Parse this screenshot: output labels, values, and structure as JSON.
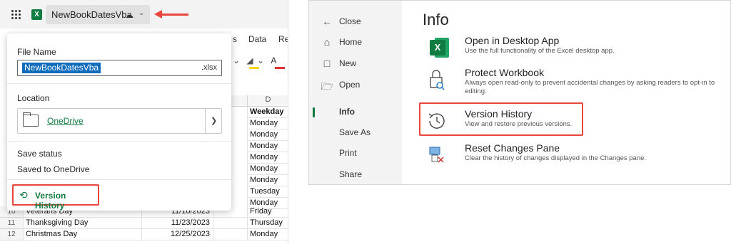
{
  "left_panel": {
    "file_title": "NewBookDatesVba",
    "ribbon_tabs": [
      "s",
      "Data",
      "Re"
    ],
    "popup": {
      "file_name_label": "File Name",
      "file_name_value": "NewBookDatesVba",
      "file_extension": ".xlsx",
      "location_label": "Location",
      "location_value": "OneDrive",
      "save_status_label": "Save status",
      "save_status_value": "Saved to OneDrive",
      "version_history_button": "Version History"
    },
    "sheet": {
      "column_header": "D",
      "header_cell": "Weekday",
      "weekdays": [
        "Monday",
        "Monday",
        "Monday",
        "Monday",
        "Monday",
        "Monday",
        "Tuesday",
        "Monday",
        "Monday"
      ],
      "rows": [
        {
          "num": "10",
          "name": "Veterans Day",
          "date": "11/10/2023",
          "weekday": "Friday"
        },
        {
          "num": "11",
          "name": "Thanksgiving Day",
          "date": "11/23/2023",
          "weekday": "Thursday"
        },
        {
          "num": "12",
          "name": "Christmas Day",
          "date": "12/25/2023",
          "weekday": "Monday"
        }
      ]
    }
  },
  "right_panel": {
    "nav": {
      "close": "Close",
      "home": "Home",
      "new": "New",
      "open": "Open",
      "info": "Info",
      "save_as": "Save As",
      "print": "Print",
      "share": "Share"
    },
    "title": "Info",
    "options": [
      {
        "title": "Open in Desktop App",
        "desc": "Use the full functionality of the Excel desktop app.",
        "icon": "excel-desktop-icon"
      },
      {
        "title": "Protect Workbook",
        "desc": "Always open read-only to prevent accidental changes by asking readers to opt-in to editing.",
        "icon": "lock-search-icon"
      },
      {
        "title": "Version History",
        "desc": "View and restore previous versions.",
        "icon": "history-clock-icon"
      },
      {
        "title": "Reset Changes Pane",
        "desc": "Clear the history of changes displayed in the Changes pane.",
        "icon": "reset-pane-icon"
      }
    ]
  },
  "colors": {
    "excel_green": "#107c41",
    "highlight_red": "#e8453c",
    "selection_blue": "#0f6cbd"
  }
}
